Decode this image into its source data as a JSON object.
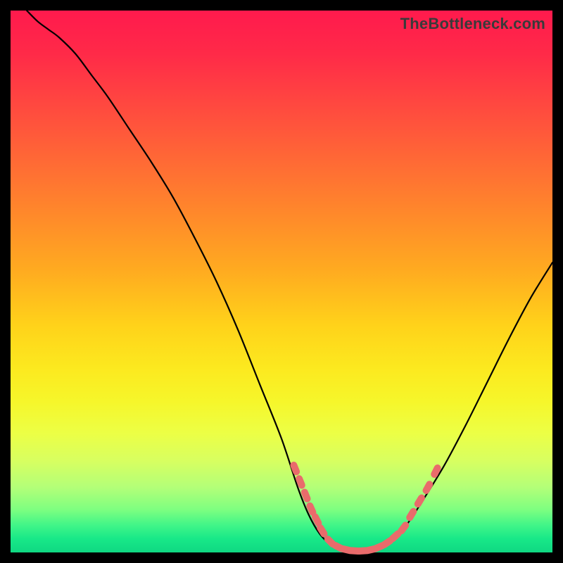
{
  "watermark": "TheBottleneck.com",
  "colors": {
    "background": "#000000",
    "curve": "#000000",
    "marker": "#e96b6b"
  },
  "chart_data": {
    "type": "line",
    "title": "",
    "xlabel": "",
    "ylabel": "",
    "xlim": [
      0,
      100
    ],
    "ylim": [
      0,
      100
    ],
    "grid": false,
    "legend": false,
    "series": [
      {
        "name": "curve",
        "x": [
          3,
          5,
          7,
          9,
          12,
          15,
          18,
          22,
          26,
          30,
          34,
          38,
          42,
          46,
          50,
          53,
          55,
          57,
          59,
          61,
          63,
          65,
          67,
          70,
          73,
          76,
          80,
          84,
          88,
          92,
          96,
          100
        ],
        "y": [
          100,
          98,
          96.5,
          95,
          92,
          88,
          84,
          78,
          72,
          65.5,
          58,
          50,
          41,
          31,
          21,
          12,
          7,
          3.5,
          1.5,
          0.5,
          0.2,
          0.2,
          0.6,
          2,
          5,
          9.5,
          16,
          23.5,
          31.5,
          39.5,
          47,
          53.5
        ]
      }
    ],
    "markers": {
      "name": "highlight-points",
      "note": "rounded-rect markers along lower V region",
      "points": [
        {
          "x": 52.5,
          "y": 15.5
        },
        {
          "x": 53.5,
          "y": 13
        },
        {
          "x": 54.5,
          "y": 10.5
        },
        {
          "x": 55.5,
          "y": 8
        },
        {
          "x": 56.5,
          "y": 6
        },
        {
          "x": 57.5,
          "y": 4
        },
        {
          "x": 59,
          "y": 2
        },
        {
          "x": 60.5,
          "y": 1
        },
        {
          "x": 62,
          "y": 0.5
        },
        {
          "x": 63.5,
          "y": 0.3
        },
        {
          "x": 65,
          "y": 0.3
        },
        {
          "x": 66.5,
          "y": 0.5
        },
        {
          "x": 68,
          "y": 1
        },
        {
          "x": 69.5,
          "y": 1.8
        },
        {
          "x": 71,
          "y": 3
        },
        {
          "x": 72.5,
          "y": 4.5
        },
        {
          "x": 74,
          "y": 7
        },
        {
          "x": 75.5,
          "y": 9.5
        },
        {
          "x": 77,
          "y": 12
        },
        {
          "x": 78.5,
          "y": 15
        }
      ]
    }
  }
}
